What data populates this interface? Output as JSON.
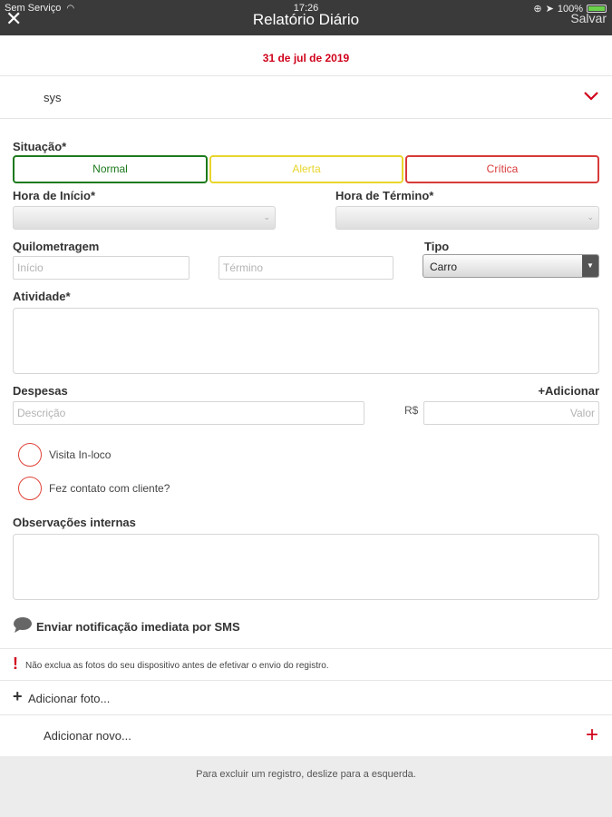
{
  "status_bar": {
    "carrier": "Sem Serviço",
    "time": "17:26",
    "battery": "100%",
    "battery_level": 1.0
  },
  "nav": {
    "close": "✕",
    "title": "Relatório Diário",
    "save": "Salvar"
  },
  "date": "31 de jul de 2019",
  "user": {
    "name": "sys"
  },
  "situacao": {
    "label": "Situação*",
    "options": [
      "Normal",
      "Alerta",
      "Crítica"
    ]
  },
  "hora_inicio": {
    "label": "Hora de Início*"
  },
  "hora_termino": {
    "label": "Hora de Término*"
  },
  "quilometragem": {
    "label": "Quilometragem",
    "inicio_placeholder": "Início",
    "termino_placeholder": "Término"
  },
  "tipo": {
    "label": "Tipo",
    "value": "Carro"
  },
  "atividade": {
    "label": "Atividade*"
  },
  "despesas": {
    "label": "Despesas",
    "add": "+Adicionar",
    "descricao_placeholder": "Descrição",
    "currency": "R$",
    "valor_placeholder": "Valor"
  },
  "checks": {
    "visita": "Visita In-loco",
    "contato": "Fez contato com cliente?"
  },
  "observacoes": {
    "label": "Observações internas"
  },
  "sms": {
    "label": "Enviar notificação imediata por SMS"
  },
  "warning": {
    "icon": "!",
    "text": "Não exclua as fotos do seu dispositivo antes de efetivar o envio do registro."
  },
  "add_foto": {
    "icon": "+",
    "label": "Adicionar foto..."
  },
  "add_novo": {
    "label": "Adicionar novo...",
    "icon": "+"
  },
  "footer": {
    "text": "Para excluir um registro, deslize para a esquerda."
  },
  "colors": {
    "accent_red": "#d0021b",
    "normal_green": "#1c7a1c",
    "alerta_yellow": "#e8d52c",
    "critica_red": "#d83a3a",
    "bar_bg": "#3a3a3a"
  }
}
